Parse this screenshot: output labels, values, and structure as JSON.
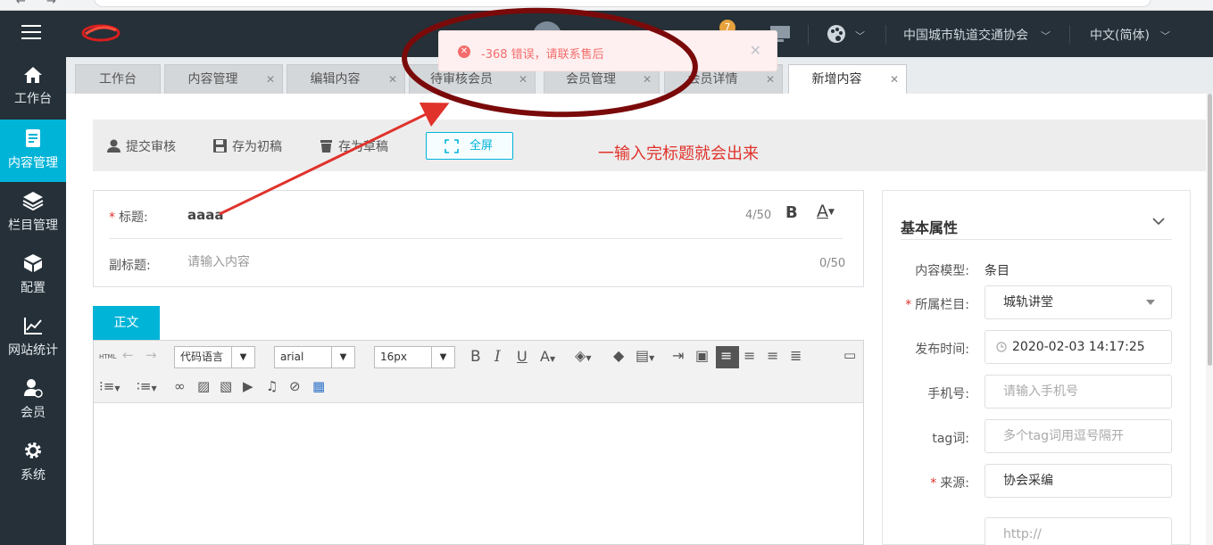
{
  "header": {
    "org_select": "中国城市轨道交通协会",
    "language_select": "中文(简体)",
    "notification_count": "7"
  },
  "sidebar": {
    "items": [
      {
        "label": "工作台",
        "icon": "home-icon"
      },
      {
        "label": "内容管理",
        "icon": "document-icon",
        "active": true
      },
      {
        "label": "栏目管理",
        "icon": "layers-icon"
      },
      {
        "label": "配置",
        "icon": "cube-icon"
      },
      {
        "label": "网站统计",
        "icon": "chart-line-icon"
      },
      {
        "label": "会员",
        "icon": "member-icon"
      },
      {
        "label": "系统",
        "icon": "gear-icon"
      }
    ]
  },
  "tabs": [
    {
      "label": "工作台",
      "closable": false
    },
    {
      "label": "内容管理",
      "closable": true
    },
    {
      "label": "编辑内容",
      "closable": true
    },
    {
      "label": "待审核会员",
      "closable": true
    },
    {
      "label": "会员管理",
      "closable": true
    },
    {
      "label": "会员详情",
      "closable": true
    },
    {
      "label": "新增内容",
      "closable": true,
      "active": true
    }
  ],
  "toolbar": {
    "submit_review": "提交审核",
    "save_initial": "存为初稿",
    "save_draft": "存为草稿",
    "fullscreen": "全屏"
  },
  "annotation": {
    "note": "一输入完标题就会出来",
    "color": "#e0322b",
    "circle_color": "#7a0a0a"
  },
  "error_toast": {
    "message": "-368 错误，请联系售后",
    "color": "#f56c6c"
  },
  "form": {
    "title_label": "标题:",
    "title_value": "aaaa",
    "title_counter": "4/50",
    "subtitle_label": "副标题:",
    "subtitle_placeholder": "请输入内容",
    "subtitle_counter": "0/50",
    "body_tab": "正文"
  },
  "editor": {
    "html_label": "HTML",
    "code_language": "代码语言",
    "font_family": "arial",
    "font_size": "16px"
  },
  "properties": {
    "title": "基本属性",
    "content_model_label": "内容模型:",
    "content_model_value": "条目",
    "column_label": "所属栏目:",
    "column_value": "城轨讲堂",
    "publish_time_label": "发布时间:",
    "publish_time_value": "2020-02-03 14:17:25",
    "phone_label": "手机号:",
    "phone_placeholder": "请输入手机号",
    "tag_label": "tag词:",
    "tag_placeholder": "多个tag词用逗号隔开",
    "source_label": "来源:",
    "source_value": "协会采编",
    "url_placeholder": "http://"
  },
  "colors": {
    "accent": "#00b4d8",
    "header_bg": "#253038",
    "required": "#e0322b"
  }
}
